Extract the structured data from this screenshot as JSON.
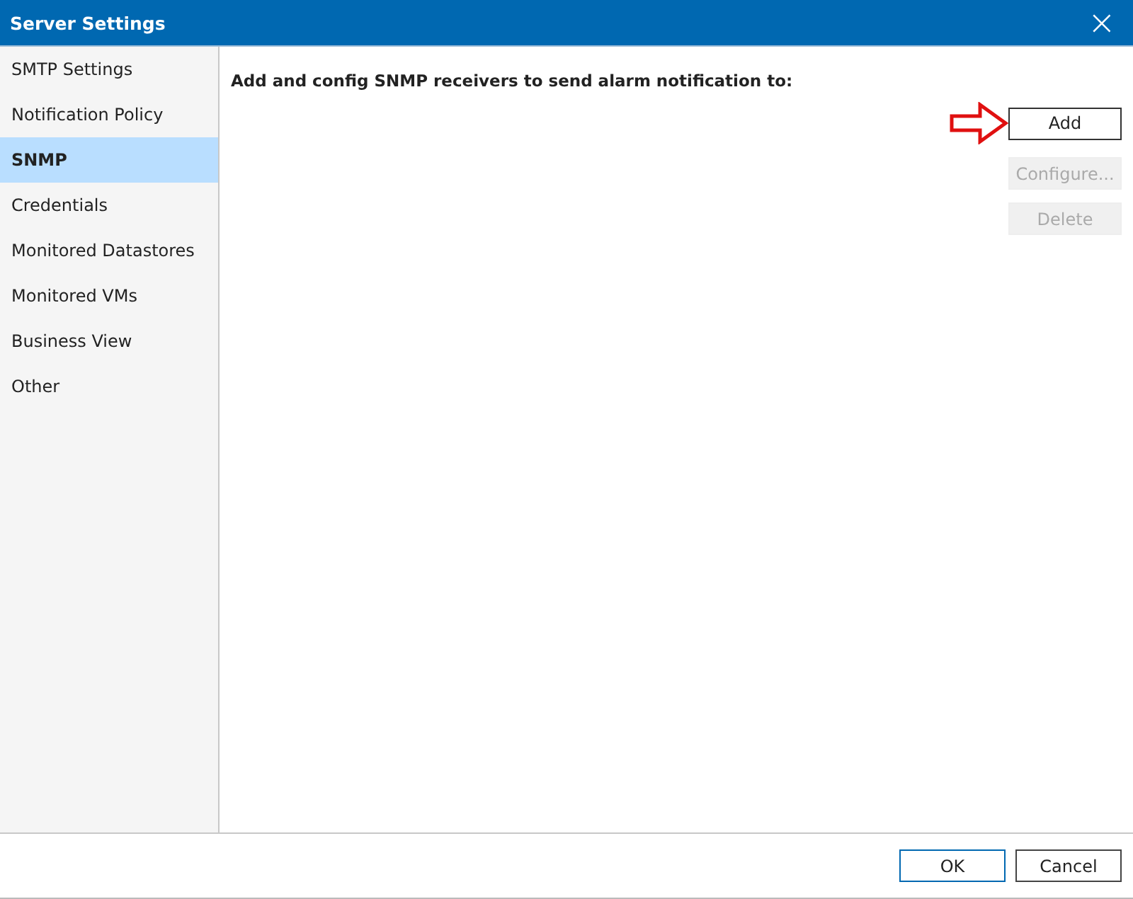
{
  "window": {
    "title": "Server Settings",
    "close": "×"
  },
  "sidebar": {
    "items": [
      {
        "label": "SMTP Settings",
        "selected": false
      },
      {
        "label": "Notification Policy",
        "selected": false
      },
      {
        "label": "SNMP",
        "selected": true
      },
      {
        "label": "Credentials",
        "selected": false
      },
      {
        "label": "Monitored Datastores",
        "selected": false
      },
      {
        "label": "Monitored VMs",
        "selected": false
      },
      {
        "label": "Business View",
        "selected": false
      },
      {
        "label": "Other",
        "selected": false
      }
    ]
  },
  "content": {
    "heading": "Add and config SNMP receivers to send alarm notification to:",
    "buttons": [
      {
        "label": "Add",
        "disabled": false,
        "highlighted": true
      },
      {
        "label": "Configure...",
        "disabled": true,
        "highlighted": false
      },
      {
        "label": "Delete",
        "disabled": true,
        "highlighted": false
      }
    ]
  },
  "footer": {
    "buttons": [
      {
        "label": "OK",
        "default": true
      },
      {
        "label": "Cancel",
        "default": false
      }
    ]
  }
}
